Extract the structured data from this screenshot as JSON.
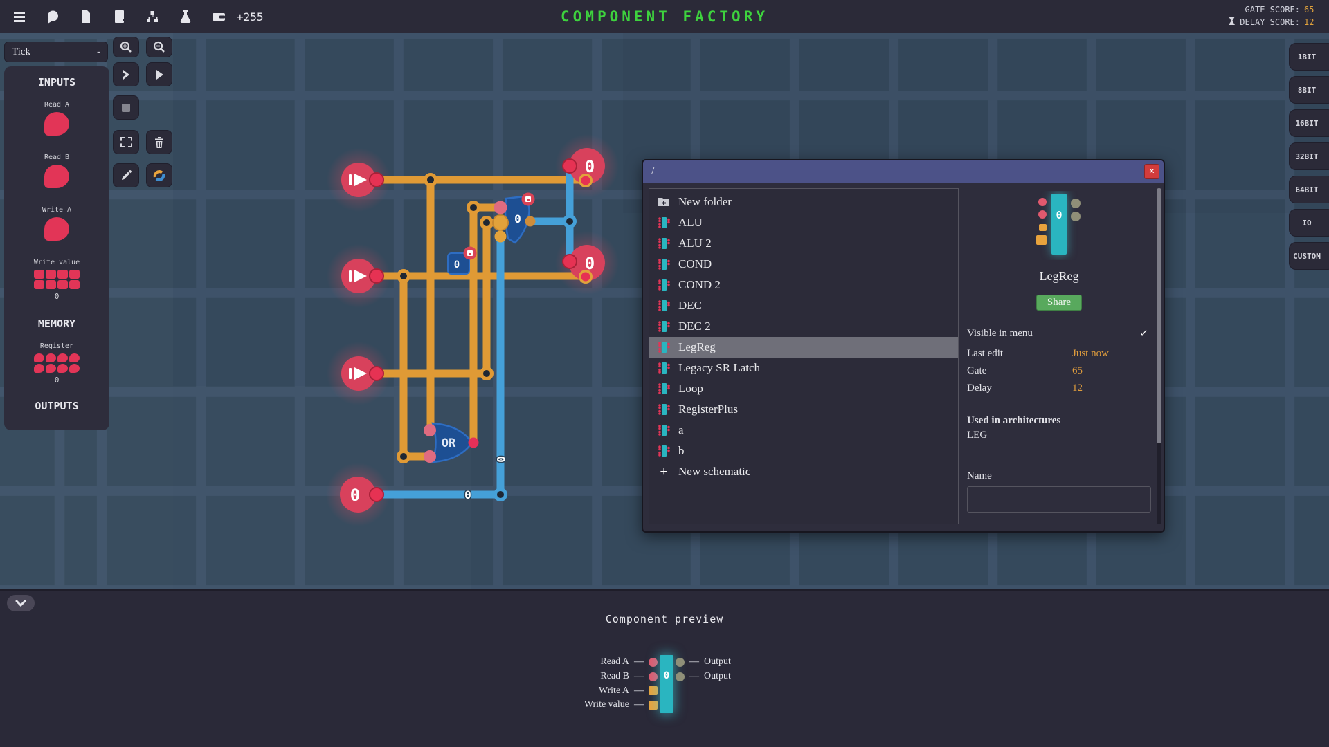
{
  "top_bar": {
    "title": "COMPONENT FACTORY",
    "money": "+255",
    "gate_score_label": "GATE SCORE:",
    "gate_score_value": "65",
    "delay_score_label": "DELAY SCORE:",
    "delay_score_value": "12"
  },
  "tick": {
    "label": "Tick",
    "collapse": "-"
  },
  "left_panel": {
    "inputs_header": "INPUTS",
    "inputs": [
      {
        "name": "Read A",
        "type": "pin"
      },
      {
        "name": "Read B",
        "type": "pin"
      },
      {
        "name": "Write A",
        "type": "pin"
      },
      {
        "name": "Write value",
        "type": "byte",
        "value": "0"
      }
    ],
    "memory_header": "MEMORY",
    "memory": [
      {
        "name": "Register",
        "type": "mem",
        "value": "0"
      }
    ],
    "outputs_header": "OUTPUTS"
  },
  "bit_buttons": [
    "1BIT",
    "8BIT",
    "16BIT",
    "32BIT",
    "64BIT",
    "IO",
    "CUSTOM"
  ],
  "canvas": {
    "or_gate_label": "OR",
    "d_register_value": "0",
    "byte_register_value": "0",
    "output_top_value": "0",
    "output_middle_value": "0",
    "output_bottom_value": "0",
    "wire_label_horizontal": "0",
    "wire_label_vertical": "0"
  },
  "dialog": {
    "path": "/",
    "close_label": "×",
    "items": [
      {
        "label": "New folder",
        "icon": "folder-plus"
      },
      {
        "label": "ALU",
        "icon": "component"
      },
      {
        "label": "ALU 2",
        "icon": "component"
      },
      {
        "label": "COND",
        "icon": "component"
      },
      {
        "label": "COND 2",
        "icon": "component"
      },
      {
        "label": "DEC",
        "icon": "component"
      },
      {
        "label": "DEC 2",
        "icon": "component"
      },
      {
        "label": "LegReg",
        "icon": "component",
        "selected": true
      },
      {
        "label": "Legacy SR Latch",
        "icon": "component"
      },
      {
        "label": "Loop",
        "icon": "component"
      },
      {
        "label": "RegisterPlus",
        "icon": "component"
      },
      {
        "label": "a",
        "icon": "component"
      },
      {
        "label": "b",
        "icon": "component"
      },
      {
        "label": "New schematic",
        "icon": "plus"
      }
    ],
    "details": {
      "component_name": "LegReg",
      "component_value": "0",
      "share_label": "Share",
      "visible_in_menu_label": "Visible in menu",
      "visible_checkmark": "✓",
      "rows": [
        {
          "label": "Last edit",
          "value": "Just now"
        },
        {
          "label": "Gate",
          "value": "65"
        },
        {
          "label": "Delay",
          "value": "12"
        }
      ],
      "used_in_header": "Used in architectures",
      "used_in_value": "LEG",
      "name_label": "Name",
      "name_value": ""
    }
  },
  "bottom_panel": {
    "title": "Component preview",
    "component": {
      "value": "0",
      "left_pins": [
        {
          "label": "Read A",
          "shape": "circle"
        },
        {
          "label": "Read B",
          "shape": "circle"
        },
        {
          "label": "Write A",
          "shape": "square"
        },
        {
          "label": "Write value",
          "shape": "square"
        }
      ],
      "right_pins": [
        {
          "label": "Output",
          "shape": "circle"
        },
        {
          "label": "Output",
          "shape": "circle"
        }
      ],
      "dash": "—"
    }
  },
  "colors": {
    "wire_orange": "#e09a35",
    "wire_blue": "#45a0d8",
    "node_red": "#d8415c",
    "component_blue": "#1d4f93",
    "teal": "#2ab5c0",
    "title_green": "#3ed23e",
    "share_green": "#58a95d",
    "dialog_titlebar": "#4c5288",
    "score_orange": "#e0a23c"
  }
}
